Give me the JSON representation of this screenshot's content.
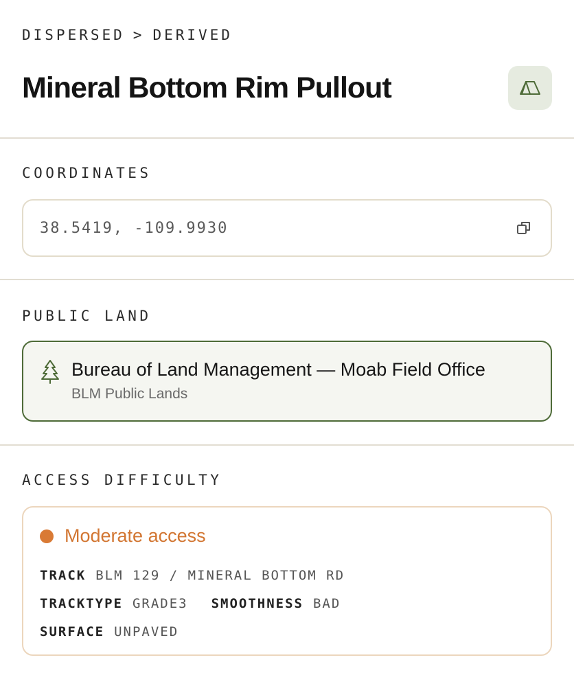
{
  "breadcrumb": {
    "parent": "DISPERSED",
    "separator": ">",
    "current": "DERIVED"
  },
  "page_title": "Mineral Bottom Rim Pullout",
  "type_badge_icon": "tent-icon",
  "coordinates": {
    "label": "COORDINATES",
    "value": "38.5419, -109.9930",
    "copy_icon": "copy-icon"
  },
  "public_land": {
    "label": "PUBLIC LAND",
    "icon": "tree-icon",
    "name": "Bureau of Land Management — Moab Field Office",
    "subtitle": "BLM Public Lands"
  },
  "access": {
    "label": "ACCESS DIFFICULTY",
    "level": "Moderate access",
    "level_color": "#d97a35",
    "rows": [
      [
        {
          "key": "TRACK",
          "value": "BLM 129 / MINERAL BOTTOM RD"
        }
      ],
      [
        {
          "key": "TRACKTYPE",
          "value": "GRADE3"
        },
        {
          "key": "SMOOTHNESS",
          "value": "BAD"
        }
      ],
      [
        {
          "key": "SURFACE",
          "value": "UNPAVED"
        }
      ]
    ]
  },
  "colors": {
    "accent_green": "#4e6b38",
    "accent_orange": "#d97a35",
    "divider": "#e2ddd2"
  }
}
